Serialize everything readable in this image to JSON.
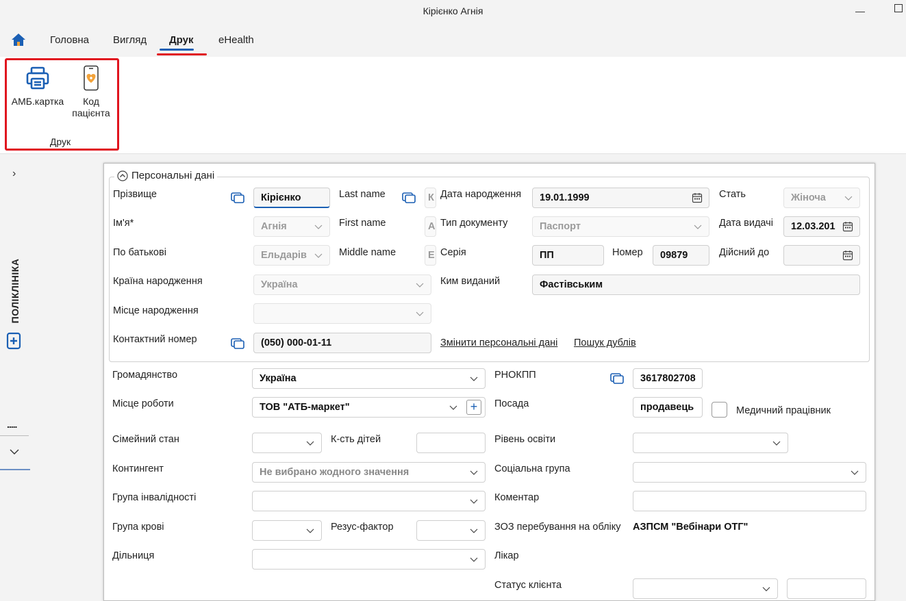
{
  "window": {
    "title": "Кірієнко Агнія"
  },
  "menu": {
    "items": [
      "Головна",
      "Вигляд",
      "Друк",
      "eHealth"
    ],
    "active": "Друк"
  },
  "ribbon": {
    "buttons": [
      {
        "label": "АМБ.картка"
      },
      {
        "label_line1": "Код",
        "label_line2": "пацієнта"
      }
    ],
    "group_label": "Друк"
  },
  "sidebar": {
    "vertical_label": "ПОЛІКЛІНІКА",
    "dots": "....."
  },
  "personal": {
    "header": "Персональні дані",
    "surname_label": "Прізвище",
    "surname": "Кірієнко",
    "lastname_label": "Last name",
    "lastname_value": "К",
    "firstname_label_ua": "Ім'я*",
    "firstname": "Агнія",
    "firstname_label_en": "First name",
    "firstname_en": "А",
    "patronymic_label": "По батькові",
    "patronymic": "Ельдарів",
    "middlename_label": "Middle name",
    "middlename": "Е",
    "birth_country_label": "Країна народження",
    "birth_country": "Україна",
    "birth_place_label": "Місце народження",
    "birth_place": "",
    "phone_label": "Контактний номер",
    "phone": "(050) 000-01-11",
    "birth_date_label": "Дата народження",
    "birth_date": "19.01.1999",
    "sex_label": "Стать",
    "sex": "Жіноча",
    "doc_type_label": "Тип документу",
    "doc_type": "Паспорт",
    "issue_date_label": "Дата видачі",
    "issue_date": "12.03.201",
    "series_label": "Серія",
    "series": "ПП",
    "number_label": "Номер",
    "number": "09879",
    "valid_to_label": "Дійсний до",
    "valid_to": "",
    "issued_by_label": "Ким виданий",
    "issued_by": "Фастівським",
    "change_link": "Змінити персональні дані",
    "duplicates_link": "Пошук дублів"
  },
  "other": {
    "citizenship_label": "Громадянство",
    "citizenship": "Україна",
    "workplace_label": "Місце роботи",
    "workplace": "ТОВ \"АТБ-маркет\"",
    "marital_label": "Сімейний стан",
    "marital": "",
    "children_label": "К-сть дітей",
    "children": "",
    "contingent_label": "Контингент",
    "contingent": "Не вибрано жодного значення",
    "disability_label": "Група інвалідності",
    "disability": "",
    "blood_label": "Група крові",
    "blood": "",
    "rh_label": "Резус-фактор",
    "rh": "",
    "district_label": "Дільниця",
    "district": "",
    "rnokpp_label": "РНОКПП",
    "rnokpp": "3617802708",
    "position_label": "Посада",
    "position": "продавець",
    "medworker_label": "Медичний працівник",
    "education_label": "Рівень освіти",
    "education": "",
    "social_label": "Соціальна група",
    "social": "",
    "comment_label": "Коментар",
    "comment": "",
    "zoz_label": "ЗОЗ перебування на обліку",
    "zoz": "АЗПСМ \"Вебінари ОТГ\"",
    "doctor_label": "Лікар",
    "client_status_label": "Статус клієнта",
    "client_status": ""
  }
}
